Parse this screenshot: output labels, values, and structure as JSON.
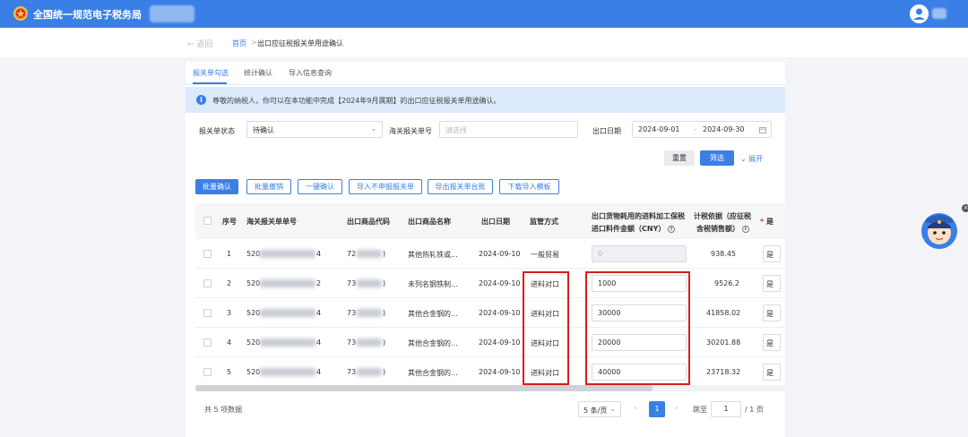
{
  "header": {
    "title": "全国统一规范电子税务局"
  },
  "breadcrumb": {
    "back": "← 返回",
    "home": "首页",
    "separator": ">",
    "current": "出口应征税报关单用途确认"
  },
  "tabs": [
    {
      "label": "报关单勾选",
      "active": true
    },
    {
      "label": "统计确认",
      "active": false
    },
    {
      "label": "导入信息查询",
      "active": false
    }
  ],
  "notice": {
    "icon": "info-icon",
    "text": "尊敬的纳税人，你可以在本功能中完成【2024年9月属期】的出口应征税报关单用途确认。"
  },
  "filters": {
    "status_label": "报关单状态",
    "status_value": "待确认",
    "customs_no_label": "海关报关单号",
    "customs_no_placeholder": "请选择",
    "date_label": "出口日期",
    "date_start": "2024-09-01",
    "date_sep": "-",
    "date_end": "2024-09-30"
  },
  "actions": {
    "reset": "重置",
    "filter": "筛选",
    "expand": "展开"
  },
  "toolbar": [
    "批量确认",
    "批量撤销",
    "一键确认",
    "导入不申报报关单",
    "导出报关单台账",
    "下载导入模板"
  ],
  "table": {
    "headers": {
      "index": "序号",
      "customs_no": "海关报关单单号",
      "goods_code": "出口商品代码",
      "goods_name": "出口商品名称",
      "export_date": "出口日期",
      "supervision": "监管方式",
      "bonded_amount_line1": "出口货物耗用的进料加工保税",
      "bonded_amount_line2": "进口料件金额（CNY）",
      "tax_basis_line1": "计税依据（应征税",
      "tax_basis_line2": "含税销售额）",
      "yes_col": "是"
    },
    "rows": [
      {
        "index": "1",
        "customs_no_prefix": "520",
        "customs_no_suffix": "4",
        "goods_code_prefix": "72",
        "goods_code_suffix": ")",
        "goods_name": "其他热轧铁或...",
        "export_date": "2024-09-10",
        "supervision": "一般贸易",
        "bonded_amount": "0",
        "bonded_disabled": true,
        "tax_basis": "938.45",
        "yes": "是"
      },
      {
        "index": "2",
        "customs_no_prefix": "520",
        "customs_no_suffix": "2",
        "goods_code_prefix": "73",
        "goods_code_suffix": ")",
        "goods_name": "未列名钢铁制...",
        "export_date": "2024-09-10",
        "supervision": "进料对口",
        "bonded_amount": "1000",
        "bonded_disabled": false,
        "tax_basis": "9526.2",
        "yes": "是"
      },
      {
        "index": "3",
        "customs_no_prefix": "520",
        "customs_no_suffix": "4",
        "goods_code_prefix": "73",
        "goods_code_suffix": ")",
        "goods_name": "其他合金钢的...",
        "export_date": "2024-09-10",
        "supervision": "进料对口",
        "bonded_amount": "30000",
        "bonded_disabled": false,
        "tax_basis": "41858.02",
        "yes": "是"
      },
      {
        "index": "4",
        "customs_no_prefix": "520",
        "customs_no_suffix": "4",
        "goods_code_prefix": "73",
        "goods_code_suffix": ")",
        "goods_name": "其他合金钢的...",
        "export_date": "2024-09-10",
        "supervision": "进料对口",
        "bonded_amount": "20000",
        "bonded_disabled": false,
        "tax_basis": "30201.88",
        "yes": "是"
      },
      {
        "index": "5",
        "customs_no_prefix": "520",
        "customs_no_suffix": "4",
        "goods_code_prefix": "73",
        "goods_code_suffix": ")",
        "goods_name": "其他合金钢的...",
        "export_date": "2024-09-10",
        "supervision": "进料对口",
        "bonded_amount": "40000",
        "bonded_disabled": false,
        "tax_basis": "23718.32",
        "yes": "是"
      }
    ]
  },
  "pagination": {
    "total": "共 5 项数据",
    "page_size": "5 条/页",
    "current_page": "1",
    "jump_label": "跳至",
    "jump_value": "1",
    "total_pages": "/ 1 页"
  },
  "colors": {
    "primary": "#3a7fe6",
    "highlight": "#d81e1e",
    "notice_bg": "#dceafb"
  }
}
